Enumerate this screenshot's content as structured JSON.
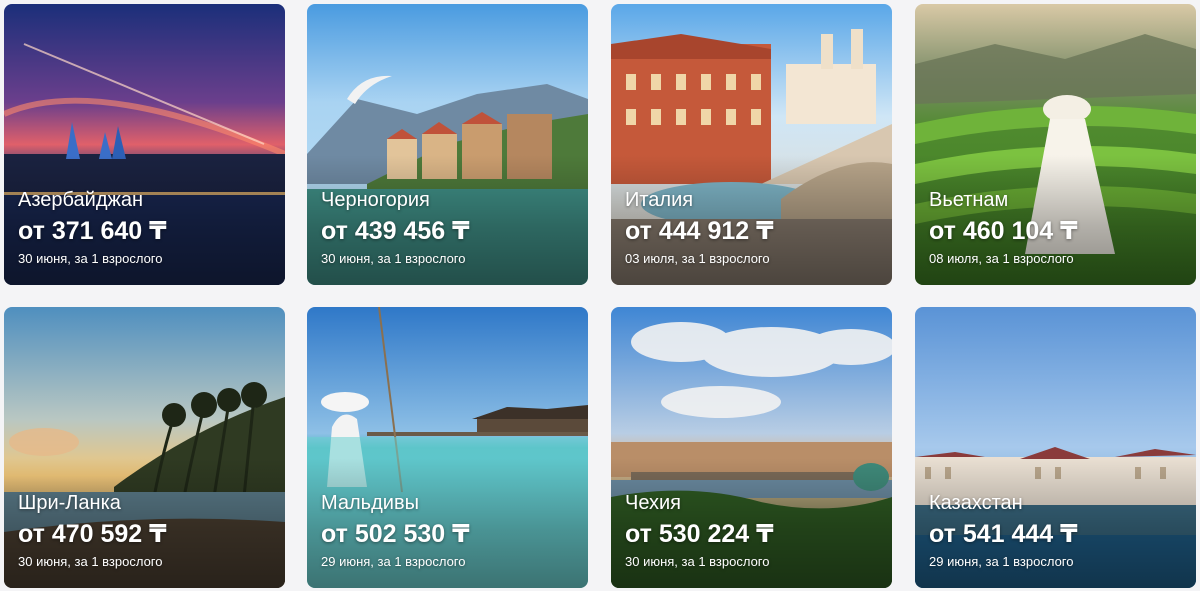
{
  "cards": [
    {
      "country": "Азербайджан",
      "price": "от 371 640 ₸",
      "meta": "30 июня, за 1 взрослого"
    },
    {
      "country": "Черногория",
      "price": "от 439 456 ₸",
      "meta": "30 июня, за 1 взрослого"
    },
    {
      "country": "Италия",
      "price": "от 444 912 ₸",
      "meta": "03 июля, за 1 взрослого"
    },
    {
      "country": "Вьетнам",
      "price": "от 460 104 ₸",
      "meta": "08 июля, за 1 взрослого"
    },
    {
      "country": "Шри-Ланка",
      "price": "от 470 592 ₸",
      "meta": "30 июня, за 1 взрослого"
    },
    {
      "country": "Мальдивы",
      "price": "от 502 530 ₸",
      "meta": "29 июня, за 1 взрослого"
    },
    {
      "country": "Чехия",
      "price": "от 530 224 ₸",
      "meta": "30 июня, за 1 взрослого"
    },
    {
      "country": "Казахстан",
      "price": "от 541 444 ₸",
      "meta": "29 июня, за 1 взрослого"
    }
  ]
}
